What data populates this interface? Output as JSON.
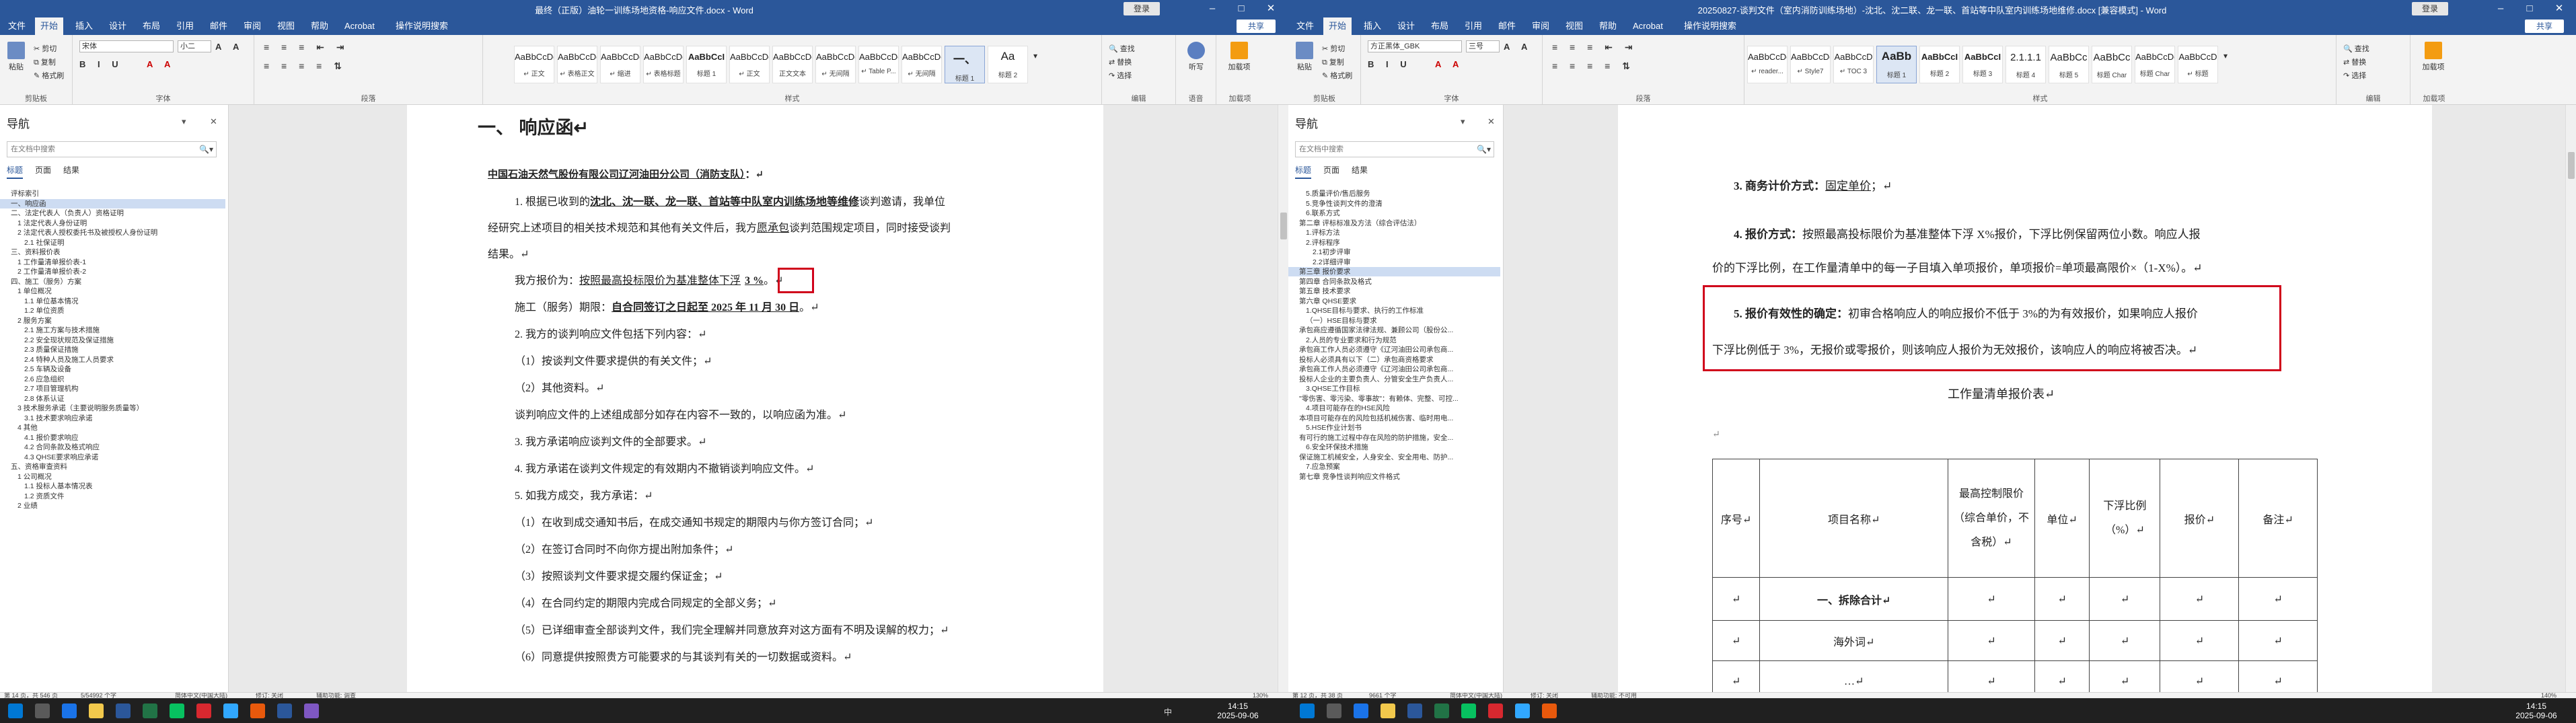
{
  "left_window": {
    "title": "最终（正版）油轮一训练场地资格-响应文件.docx - Word",
    "login": "登录",
    "tabs": [
      "文件",
      "开始",
      "插入",
      "设计",
      "布局",
      "引用",
      "邮件",
      "审阅",
      "视图",
      "帮助",
      "Acrobat",
      "操作说明搜索"
    ],
    "share": "共享",
    "ribbon": {
      "paste": "粘贴",
      "cut": "剪切",
      "copy": "复制",
      "format_painter": "格式刷",
      "clipboard_label": "剪贴板",
      "font_name": "宋体",
      "font_size": "小二",
      "font_label": "字体",
      "para_label": "段落",
      "style_label": "样式",
      "styles": [
        {
          "preview": "AaBbCcDc",
          "name": "↵ 正文"
        },
        {
          "preview": "AaBbCcDc",
          "name": "↵ 表格正文"
        },
        {
          "preview": "AaBbCcDc",
          "name": "↵ 缩进"
        },
        {
          "preview": "AaBbCcDc",
          "name": "↵ 表格标题"
        },
        {
          "preview": "AaBbCcI",
          "name": "标题 1"
        },
        {
          "preview": "AaBbCcDc",
          "name": "↵ 正文"
        },
        {
          "preview": "AaBbCcDc",
          "name": "正文文本"
        },
        {
          "preview": "AaBbCcDc",
          "name": "↵ 无间隔"
        },
        {
          "preview": "AaBbCcDc",
          "name": "↵ Table P..."
        },
        {
          "preview": "AaBbCcDc",
          "name": "↵ 无间隔"
        },
        {
          "preview": "一、",
          "name": "标题 1"
        },
        {
          "preview": "Aa",
          "name": "标题 2"
        }
      ],
      "find": "查找",
      "replace": "替换",
      "select": "选择",
      "edit_label": "编辑",
      "dictate": "听写",
      "voice_label": "语音",
      "addins": "加载项",
      "addins_label": "加载项"
    },
    "nav": {
      "title": "导航",
      "search_placeholder": "在文档中搜索",
      "tabs": [
        "标题",
        "页面",
        "结果"
      ],
      "items": [
        "评标索引",
        "一、响应函",
        "二、法定代表人（负责人）资格证明",
        "1 法定代表人身份证明",
        "2 法定代表人授权委托书及被授权人身份证明",
        "2.1 社保证明",
        "三、资料报价表",
        "1 工作量清单报价表-1",
        "2 工作量清单报价表-2",
        "四、施工（服务）方案",
        "1 单位概况",
        "1.1 单位基本情况",
        "1.2 单位资质",
        "2 服务方案",
        "2.1 施工方案与技术措施",
        "2.2 安全现状规范及保证措施",
        "2.3 质量保证措施",
        "2.4 特种人员及施工人员要求",
        "2.5 车辆及设备",
        "2.6 应急组织",
        "2.7 项目管理机构",
        "2.8 体系认证",
        "3 技术服务承诺（主要说明服务质量等）",
        "3.1 技术要求响应承诺",
        "4 其他",
        "4.1 报价要求响应",
        "4.2 合同条款及格式响应",
        "4.3 QHSE要求响应承诺",
        "五、资格审查资料",
        "1 公司概况",
        "1.1 投标人基本情况表",
        "1.2 资质文件",
        "2 业绩"
      ]
    },
    "doc": {
      "heading": "一、 响应函↵",
      "recipient": "中国石油天然气股份有限公司辽河油田分公司（消防支队）",
      "recipient_suffix": "：↵",
      "p1a": "1. 根据已收到的",
      "p1b": "沈北、沈一联、龙一联、首站等中队室内训练场地等维修",
      "p1c": "谈判邀请，我单位",
      "p2a": "经研究上述项目的相关技术规范和其他有关文件后，我方",
      "p2b": "愿承包",
      "p2c": "谈判范围规定项目，同时接受谈判",
      "p3": "结果。↵",
      "p4a": "我方报价为：",
      "p4b": "按照最高投标限价为基准整体下浮",
      "p4c": "3 %",
      "p4d": "。↵",
      "p5a": "施工（服务）期限：",
      "p5b": "自合同签订之日起至 2025 年 11 月 30 日",
      "p5c": "。↵",
      "p6": "2. 我方的谈判响应文件包括下列内容：↵",
      "p7": "（1）按谈判文件要求提供的有关文件；↵",
      "p8": "（2）其他资料。↵",
      "p9": "谈判响应文件的上述组成部分如存在内容不一致的，以响应函为准。↵",
      "p10": "3. 我方承诺响应谈判文件的全部要求。↵",
      "p11": "4. 我方承诺在谈判文件规定的有效期内不撤销谈判响应文件。↵",
      "p12": "5. 如我方成交，我方承诺：↵",
      "p13": "（1）在收到成交通知书后，在成交通知书规定的期限内与你方签订合同；↵",
      "p14": "（2）在签订合同时不向你方提出附加条件；↵",
      "p15": "（3）按照谈判文件要求提交履约保证金；↵",
      "p16": "（4）在合同约定的期限内完成合同规定的全部义务；↵",
      "p17": "（5）已详细审查全部谈判文件，我们完全理解并同意放弃对这方面有不明及误解的权力；↵",
      "p18": "（6）同意提供按照贵方可能要求的与其谈判有关的一切数据或资料。↵"
    },
    "status": {
      "page": "第 14 页，共 546 页",
      "words": "5/54992 个字",
      "lang": "简体中文(中国大陆)",
      "track": "修订: 关闭",
      "access": "辅助功能: 调查",
      "zoom": "130%"
    }
  },
  "right_window": {
    "title": "20250827-谈判文件（室内消防训练场地）-沈北、沈二联、龙一联、首站等中队室内训练场地维修.docx [兼容模式] - Word",
    "login": "登录",
    "tabs": [
      "文件",
      "开始",
      "插入",
      "设计",
      "布局",
      "引用",
      "邮件",
      "审阅",
      "视图",
      "帮助",
      "Acrobat",
      "操作说明搜索"
    ],
    "share": "共享",
    "ribbon": {
      "paste": "粘贴",
      "cut": "剪切",
      "copy": "复制",
      "format_painter": "格式刷",
      "clipboard_label": "剪贴板",
      "font_name": "方正黑体_GBK",
      "font_size": "三号",
      "font_label": "字体",
      "para_label": "段落",
      "style_label": "样式",
      "styles": [
        {
          "preview": "AaBbCcDc",
          "name": "↵ reader..."
        },
        {
          "preview": "AaBbCcDc",
          "name": "↵ Style7"
        },
        {
          "preview": "AaBbCcD",
          "name": "↵ TOC 3"
        },
        {
          "preview": "AaBb",
          "name": "标题 1"
        },
        {
          "preview": "AaBbCcI",
          "name": "标题 2"
        },
        {
          "preview": "AaBbCcI",
          "name": "标题 3"
        },
        {
          "preview": "2.1.1.1",
          "name": "标题 4"
        },
        {
          "preview": "AaBbCc",
          "name": "标题 5"
        },
        {
          "preview": "AaBbCc",
          "name": "标题 Char"
        },
        {
          "preview": "AaBbCcDc",
          "name": "标题 Char"
        },
        {
          "preview": "AaBbCcD",
          "name": "↵ 标题"
        }
      ],
      "find": "查找",
      "replace": "替换",
      "select": "选择",
      "edit_label": "编辑",
      "addins": "加载项",
      "addins_label": "加载项"
    },
    "nav": {
      "title": "导航",
      "search_placeholder": "在文档中搜索",
      "tabs": [
        "标题",
        "页面",
        "结果"
      ],
      "items": [
        "5.质量评价/售后服务",
        "5.竞争性谈判文件的澄清",
        "6.联系方式",
        "第二章 评标标准及方法（综合评估法）",
        "1.评标方法",
        "2.评标程序",
        "2.1初步评审",
        "2.2详细评审",
        "第三章 报价要求",
        "第四章 合同条款及格式",
        "第五章 技术要求",
        "第六章 QHSE要求",
        "1.QHSE目标与要求、执行的工作标准",
        "（一）HSE目标与要求",
        "承包商应遵循国家法律法规、兼顾公司（股份公...",
        "2.人员的专业要求和行为规范",
        "承包商工作人员必须遵守《辽河油田公司承包商...",
        "投标人必须具有以下（二）承包商资格要求",
        "承包商工作人员必须遵守《辽河油田公司承包商...",
        "投标人企业的主要负责人、分管安全生产负责人...",
        "3.QHSE工作目标",
        "\"零伤害、零污染、零事故\"：有赖体、完整、可控...",
        "4.项目可能存在的HSE风险",
        "本项目可能存在的风险包括机械伤害、临时用电...",
        "5.HSE作业计划书",
        "有可行的施工过程中存在风险的防护措施，安全...",
        "6.安全环保技术措施",
        "保证施工机械安全，人身安全、安全用电、防护...",
        "7.应急预案",
        "第七章 竞争性谈判响应文件格式"
      ]
    },
    "doc": {
      "p_a1": "3. 商务计价方式：",
      "p_a2": "固定单价",
      "p_a3": "；↵",
      "p_b1": "4. 报价方式：",
      "p_b2": "按照最高投标限价为基准整体下浮 X%报价，下浮比例保留两位小数。响应人报",
      "p_c": "价的下浮比例，在工作量清单中的每一子目填入单项报价，单项报价=单项最高限价×（1-X%）。↵",
      "p_d1": "5. 报价有效性的确定：",
      "p_d2": "初审合格响应人的响应报价不低于 3%的为有效报价，如果响应人报价",
      "p_e": "下浮比例低于 3%，无报价或零报价，则该响应人报价为无效报价，该响应人的响应将被否决。↵",
      "table_title": "工作量清单报价表↵",
      "empty_mark": "↵",
      "table_headers": [
        "序号↵",
        "项目名称↵",
        "最高控制限价（综合单价，不含税）↵",
        "单位↵",
        "下浮比例（%）↵",
        "报价↵",
        "备注↵"
      ],
      "table_rows": [
        [
          "↵",
          "一、拆除合计↵",
          "↵",
          "↵",
          "↵",
          "↵",
          "↵"
        ],
        [
          "↵",
          "海外词↵",
          "↵",
          "↵",
          "↵",
          "↵",
          "↵"
        ],
        [
          "↵",
          "…↵",
          "↵",
          "↵",
          "↵",
          "↵",
          "↵"
        ]
      ]
    },
    "status": {
      "page": "第 12 页，共 38 页",
      "words": "9661 个字",
      "lang": "简体中文(中国大陆)",
      "track": "修订: 关闭",
      "access": "辅助功能: 不可用",
      "zoom": "140%"
    }
  },
  "taskbar": {
    "left_clock_time": "14:15",
    "left_clock_date": "2025-09-06",
    "right_clock_time": "14:15",
    "right_clock_date": "2025-09-06",
    "ime": "中"
  }
}
